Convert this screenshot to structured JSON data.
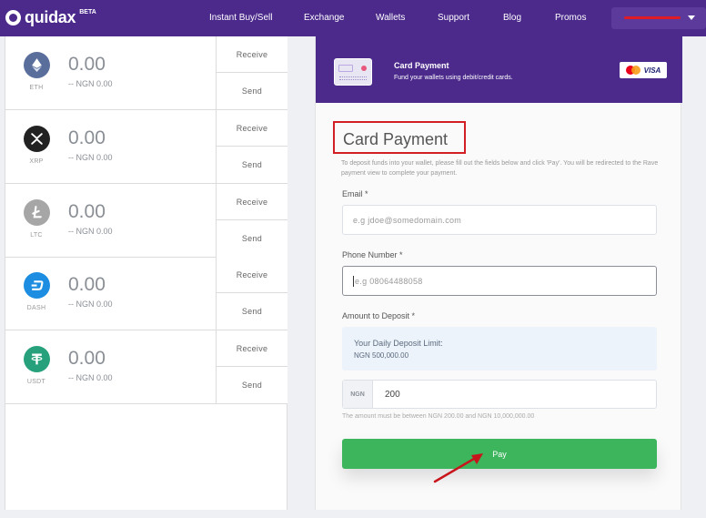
{
  "nav": {
    "logo_text": "quidax",
    "logo_badge": "BETA",
    "links": [
      "Instant Buy/Sell",
      "Exchange",
      "Wallets",
      "Support",
      "Blog",
      "Promos"
    ],
    "user_icon": "caret-down-icon"
  },
  "wallets": [
    {
      "symbol": "ETH",
      "amount": "0.00",
      "fiat": "-- NGN 0.00",
      "icon": "ethereum-icon",
      "color": "#627eea",
      "receive": "Receive",
      "send": "Send"
    },
    {
      "symbol": "XRP",
      "amount": "0.00",
      "fiat": "-- NGN 0.00",
      "icon": "xrp-icon",
      "color": "#222222",
      "receive": "Receive",
      "send": "Send"
    },
    {
      "symbol": "LTC",
      "amount": "0.00",
      "fiat": "-- NGN 0.00",
      "icon": "litecoin-icon",
      "color": "#a6a6a6",
      "receive": "Receive",
      "send": "Send"
    },
    {
      "symbol": "DASH",
      "amount": "0.00",
      "fiat": "-- NGN 0.00",
      "icon": "dash-icon",
      "color": "#1c8de0",
      "receive": "Receive",
      "send": "Send"
    },
    {
      "symbol": "USDT",
      "amount": "0.00",
      "fiat": "-- NGN 0.00",
      "icon": "tether-icon",
      "color": "#26a17b",
      "receive": "Receive",
      "send": "Send"
    }
  ],
  "panel": {
    "header_title": "Card Payment",
    "header_subtitle": "Fund your wallets using debit/credit cards.",
    "visa_text": "VISA",
    "form_title": "Card Payment",
    "description": "To deposit funds into your wallet, please fill out the fields below and click 'Pay'. You will be redirected to the Rave payment view to complete your payment.",
    "email_label": "Email *",
    "email_placeholder": "e.g jdoe@somedomain.com",
    "phone_label": "Phone Number *",
    "phone_placeholder": "e.g 08064488058",
    "amount_label": "Amount to Deposit *",
    "limit_title": "Your Daily Deposit Limit:",
    "limit_value": "NGN 500,000.00",
    "currency": "NGN",
    "amount_value": "200",
    "amount_hint": "The amount must be between NGN 200.00 and NGN 10,000,000.00",
    "pay_label": "Pay"
  },
  "colors": {
    "brand": "#4b2a8c",
    "pay": "#3cb55c",
    "highlight": "#d21f26"
  }
}
